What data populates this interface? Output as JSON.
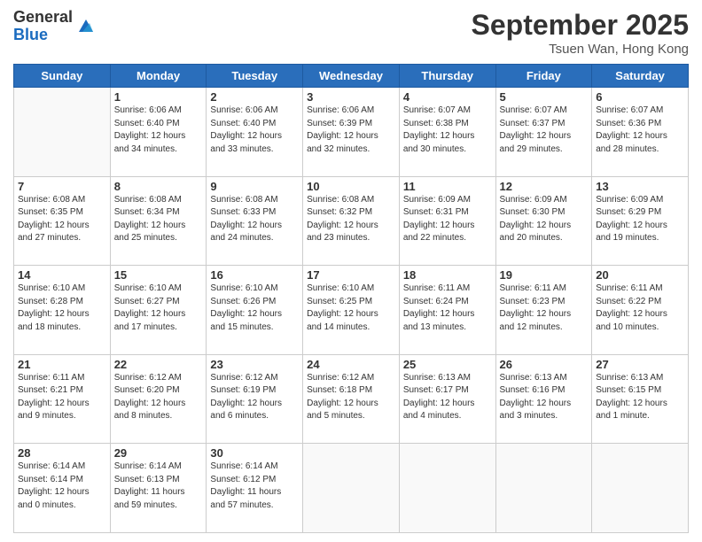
{
  "logo": {
    "general": "General",
    "blue": "Blue"
  },
  "title": "September 2025",
  "location": "Tsuen Wan, Hong Kong",
  "days_header": [
    "Sunday",
    "Monday",
    "Tuesday",
    "Wednesday",
    "Thursday",
    "Friday",
    "Saturday"
  ],
  "weeks": [
    [
      {
        "day": "",
        "info": ""
      },
      {
        "day": "1",
        "info": "Sunrise: 6:06 AM\nSunset: 6:40 PM\nDaylight: 12 hours\nand 34 minutes."
      },
      {
        "day": "2",
        "info": "Sunrise: 6:06 AM\nSunset: 6:40 PM\nDaylight: 12 hours\nand 33 minutes."
      },
      {
        "day": "3",
        "info": "Sunrise: 6:06 AM\nSunset: 6:39 PM\nDaylight: 12 hours\nand 32 minutes."
      },
      {
        "day": "4",
        "info": "Sunrise: 6:07 AM\nSunset: 6:38 PM\nDaylight: 12 hours\nand 30 minutes."
      },
      {
        "day": "5",
        "info": "Sunrise: 6:07 AM\nSunset: 6:37 PM\nDaylight: 12 hours\nand 29 minutes."
      },
      {
        "day": "6",
        "info": "Sunrise: 6:07 AM\nSunset: 6:36 PM\nDaylight: 12 hours\nand 28 minutes."
      }
    ],
    [
      {
        "day": "7",
        "info": "Sunrise: 6:08 AM\nSunset: 6:35 PM\nDaylight: 12 hours\nand 27 minutes."
      },
      {
        "day": "8",
        "info": "Sunrise: 6:08 AM\nSunset: 6:34 PM\nDaylight: 12 hours\nand 25 minutes."
      },
      {
        "day": "9",
        "info": "Sunrise: 6:08 AM\nSunset: 6:33 PM\nDaylight: 12 hours\nand 24 minutes."
      },
      {
        "day": "10",
        "info": "Sunrise: 6:08 AM\nSunset: 6:32 PM\nDaylight: 12 hours\nand 23 minutes."
      },
      {
        "day": "11",
        "info": "Sunrise: 6:09 AM\nSunset: 6:31 PM\nDaylight: 12 hours\nand 22 minutes."
      },
      {
        "day": "12",
        "info": "Sunrise: 6:09 AM\nSunset: 6:30 PM\nDaylight: 12 hours\nand 20 minutes."
      },
      {
        "day": "13",
        "info": "Sunrise: 6:09 AM\nSunset: 6:29 PM\nDaylight: 12 hours\nand 19 minutes."
      }
    ],
    [
      {
        "day": "14",
        "info": "Sunrise: 6:10 AM\nSunset: 6:28 PM\nDaylight: 12 hours\nand 18 minutes."
      },
      {
        "day": "15",
        "info": "Sunrise: 6:10 AM\nSunset: 6:27 PM\nDaylight: 12 hours\nand 17 minutes."
      },
      {
        "day": "16",
        "info": "Sunrise: 6:10 AM\nSunset: 6:26 PM\nDaylight: 12 hours\nand 15 minutes."
      },
      {
        "day": "17",
        "info": "Sunrise: 6:10 AM\nSunset: 6:25 PM\nDaylight: 12 hours\nand 14 minutes."
      },
      {
        "day": "18",
        "info": "Sunrise: 6:11 AM\nSunset: 6:24 PM\nDaylight: 12 hours\nand 13 minutes."
      },
      {
        "day": "19",
        "info": "Sunrise: 6:11 AM\nSunset: 6:23 PM\nDaylight: 12 hours\nand 12 minutes."
      },
      {
        "day": "20",
        "info": "Sunrise: 6:11 AM\nSunset: 6:22 PM\nDaylight: 12 hours\nand 10 minutes."
      }
    ],
    [
      {
        "day": "21",
        "info": "Sunrise: 6:11 AM\nSunset: 6:21 PM\nDaylight: 12 hours\nand 9 minutes."
      },
      {
        "day": "22",
        "info": "Sunrise: 6:12 AM\nSunset: 6:20 PM\nDaylight: 12 hours\nand 8 minutes."
      },
      {
        "day": "23",
        "info": "Sunrise: 6:12 AM\nSunset: 6:19 PM\nDaylight: 12 hours\nand 6 minutes."
      },
      {
        "day": "24",
        "info": "Sunrise: 6:12 AM\nSunset: 6:18 PM\nDaylight: 12 hours\nand 5 minutes."
      },
      {
        "day": "25",
        "info": "Sunrise: 6:13 AM\nSunset: 6:17 PM\nDaylight: 12 hours\nand 4 minutes."
      },
      {
        "day": "26",
        "info": "Sunrise: 6:13 AM\nSunset: 6:16 PM\nDaylight: 12 hours\nand 3 minutes."
      },
      {
        "day": "27",
        "info": "Sunrise: 6:13 AM\nSunset: 6:15 PM\nDaylight: 12 hours\nand 1 minute."
      }
    ],
    [
      {
        "day": "28",
        "info": "Sunrise: 6:14 AM\nSunset: 6:14 PM\nDaylight: 12 hours\nand 0 minutes."
      },
      {
        "day": "29",
        "info": "Sunrise: 6:14 AM\nSunset: 6:13 PM\nDaylight: 11 hours\nand 59 minutes."
      },
      {
        "day": "30",
        "info": "Sunrise: 6:14 AM\nSunset: 6:12 PM\nDaylight: 11 hours\nand 57 minutes."
      },
      {
        "day": "",
        "info": ""
      },
      {
        "day": "",
        "info": ""
      },
      {
        "day": "",
        "info": ""
      },
      {
        "day": "",
        "info": ""
      }
    ]
  ]
}
